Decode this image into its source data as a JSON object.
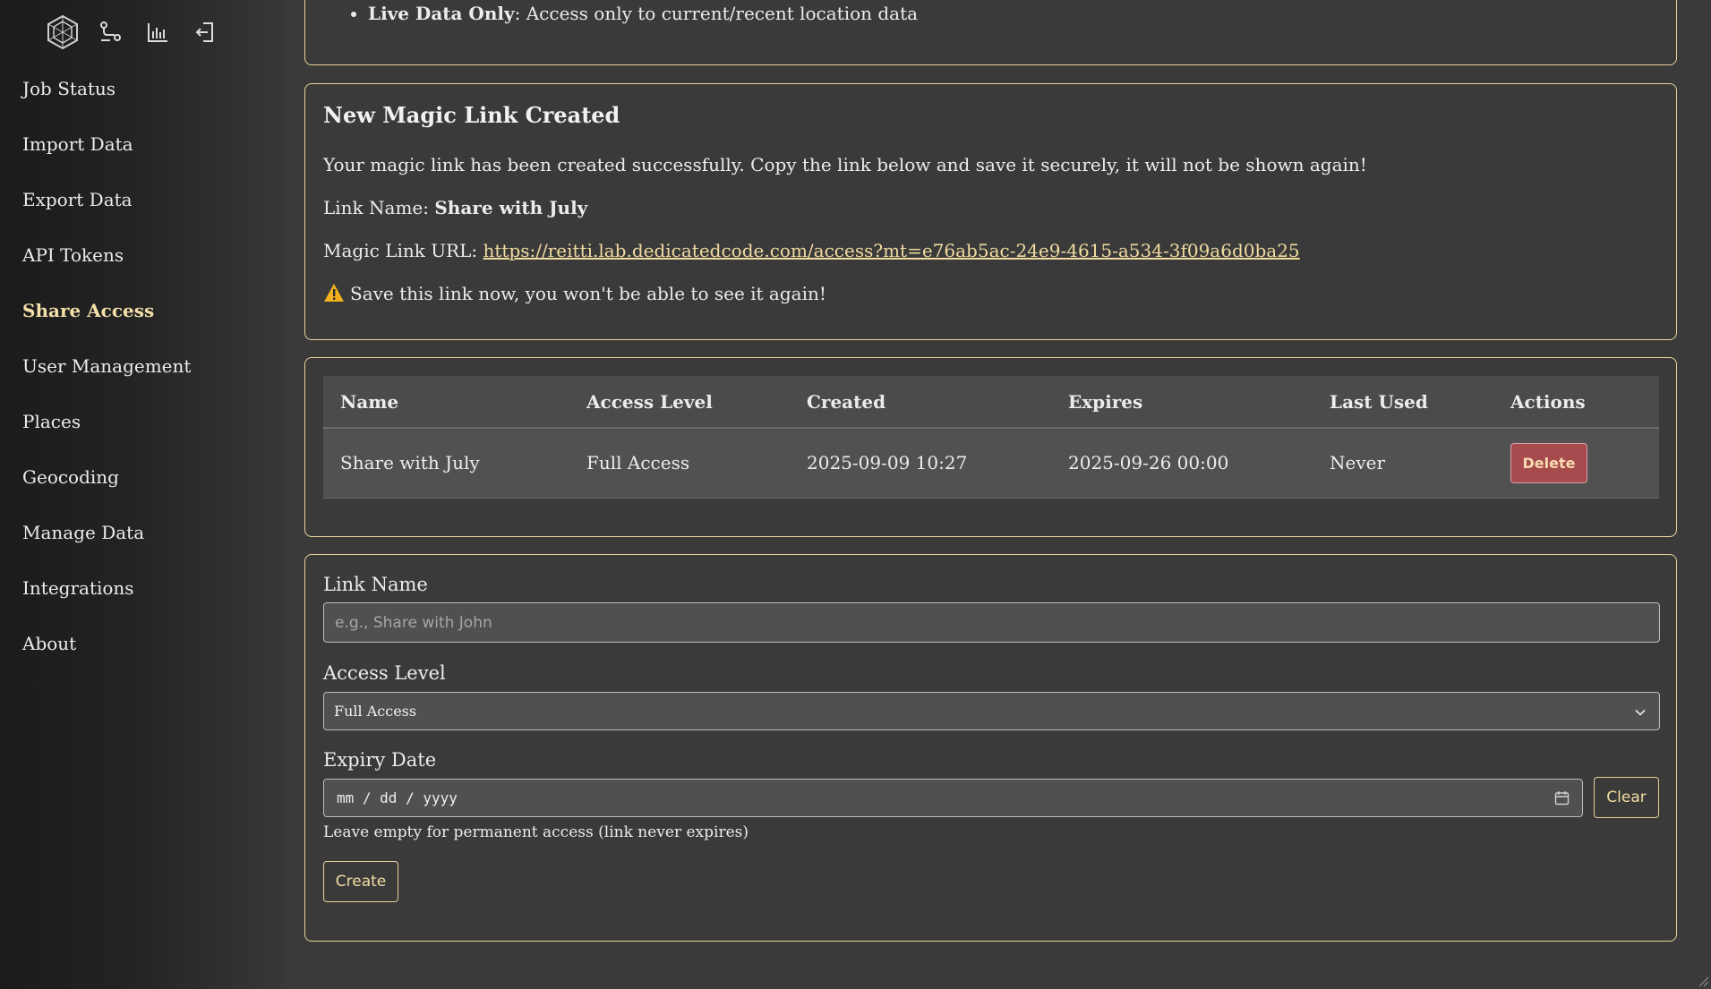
{
  "topbar": {
    "icons": [
      "logo-icon",
      "timeline-icon",
      "statistics-icon",
      "logout-icon"
    ]
  },
  "sidebar": {
    "items": [
      {
        "label": "Job Status"
      },
      {
        "label": "Import Data"
      },
      {
        "label": "Export Data"
      },
      {
        "label": "API Tokens"
      },
      {
        "label": "Share Access",
        "active": true
      },
      {
        "label": "User Management"
      },
      {
        "label": "Places"
      },
      {
        "label": "Geocoding"
      },
      {
        "label": "Manage Data"
      },
      {
        "label": "Integrations"
      },
      {
        "label": "About"
      }
    ]
  },
  "access_levels": {
    "live_only_title": "Live Data Only",
    "live_only_desc": ": Access only to current/recent location data"
  },
  "created": {
    "title": "New Magic Link Created",
    "message": "Your magic link has been created successfully. Copy the link below and save it securely, it will not be shown again!",
    "name_label": "Link Name: ",
    "name_value": "Share with July",
    "url_label": "Magic Link URL: ",
    "url": "https://reitti.lab.dedicatedcode.com/access?mt=e76ab5ac-24e9-4615-a534-3f09a6d0ba25",
    "warning": "Save this link now, you won't be able to see it again!"
  },
  "table": {
    "headers": [
      "Name",
      "Access Level",
      "Created",
      "Expires",
      "Last Used",
      "Actions"
    ],
    "rows": [
      {
        "name": "Share with July",
        "access": "Full Access",
        "created": "2025-09-09 10:27",
        "expires": "2025-09-26 00:00",
        "last_used": "Never",
        "action": "Delete"
      }
    ]
  },
  "form": {
    "link_name_label": "Link Name",
    "link_name_placeholder": "e.g., Share with John",
    "access_level_label": "Access Level",
    "access_level_value": "Full Access",
    "expiry_label": "Expiry Date",
    "expiry_placeholder": "mm / dd / yyyy",
    "clear_label": "Clear",
    "hint": "Leave empty for permanent access (link never expires)",
    "create_label": "Create"
  },
  "colors": {
    "accent": "#f1dca0",
    "border": "#e6d39c",
    "danger": "#a64a4e",
    "background": "#3a3a3a"
  }
}
